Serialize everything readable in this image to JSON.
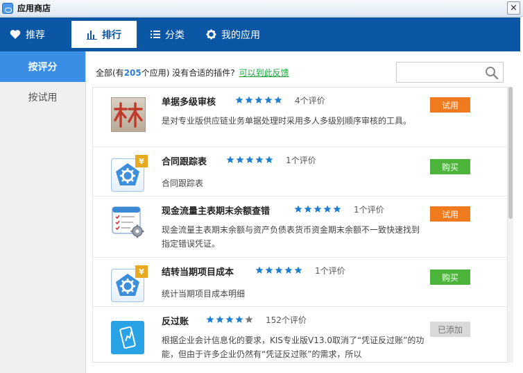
{
  "window": {
    "title": "应用商店",
    "close_label": "×"
  },
  "nav": {
    "tabs": [
      {
        "label": "推荐",
        "icon": "heart-icon"
      },
      {
        "label": "排行",
        "icon": "bar-chart-icon"
      },
      {
        "label": "分类",
        "icon": "list-icon"
      },
      {
        "label": "我的应用",
        "icon": "gear-icon"
      }
    ],
    "active": "排行"
  },
  "sidebar": {
    "items": [
      {
        "label": "按评分",
        "active": true
      },
      {
        "label": "按试用",
        "active": false
      }
    ]
  },
  "summary": {
    "prefix": "全部(有",
    "count": "205",
    "suffix": "个应用) 没有合适的插件?",
    "link": "可以到此反馈"
  },
  "search": {
    "placeholder": ""
  },
  "apps": [
    {
      "name": "单据多级审核",
      "rating": 5,
      "reviews": "4个评价",
      "desc": "是对专业版供应链业务单据处理时采用多人多级别顺序审核的工具。",
      "action": "试用",
      "action_type": "trial",
      "icon": "lin-character-icon"
    },
    {
      "name": "合同跟踪表",
      "rating": 5,
      "reviews": "1个评价",
      "desc": "合同跟踪表",
      "action": "购买",
      "action_type": "buy",
      "icon": "gear-pentagon-icon"
    },
    {
      "name": "现金流量主表期末余额查错",
      "rating": 5,
      "reviews": "1个评价",
      "desc": "现金流量主表期末余额与资产负债表货币资金期末余额不一致快速找到指定错误凭证。",
      "action": "试用",
      "action_type": "trial",
      "icon": "checklist-gear-icon"
    },
    {
      "name": "结转当期项目成本",
      "rating": 5,
      "reviews": "1个评价",
      "desc": "统计当期项目成本明细",
      "action": "购买",
      "action_type": "buy",
      "icon": "gear-pentagon-icon"
    },
    {
      "name": "反过账",
      "rating": 4,
      "reviews": "152个评价",
      "desc": "根据企业会计信息化的要求，KIS专业版V13.0取消了“凭证反过账”的功能，但由于许多企业仍然有“凭证反过账”的需求，所以",
      "action": "已添加",
      "action_type": "added",
      "icon": "phone-chart-icon"
    }
  ],
  "colors": {
    "nav_bg": "#0b57a6",
    "sidebar_active": "#3a8ee6",
    "trial": "#f07a1e",
    "buy": "#4cb43a",
    "added": "#d9d9d9",
    "star": "#1e7fd0"
  }
}
